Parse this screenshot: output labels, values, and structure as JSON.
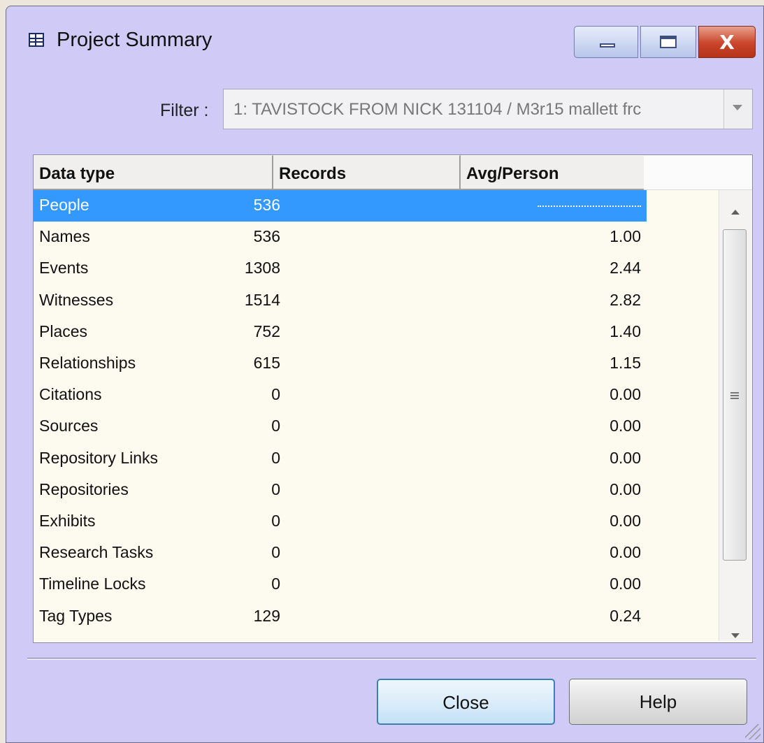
{
  "window": {
    "title": "Project Summary",
    "icon": "table-icon",
    "controls": [
      "minimize-icon",
      "maximize-icon",
      "close-icon"
    ],
    "close_glyph": "X"
  },
  "filter": {
    "label": "Filter :",
    "value": "1:  TAVISTOCK FROM NICK 131104 / M3r15 mallett frc"
  },
  "table": {
    "columns": [
      "Data type",
      "Records",
      "Avg/Person"
    ],
    "selected_row": 0,
    "rows": [
      {
        "type": "People",
        "records": "536",
        "avg": ""
      },
      {
        "type": "Names",
        "records": "536",
        "avg": "1.00"
      },
      {
        "type": "Events",
        "records": "1308",
        "avg": "2.44"
      },
      {
        "type": "Witnesses",
        "records": "1514",
        "avg": "2.82"
      },
      {
        "type": "Places",
        "records": "752",
        "avg": "1.40"
      },
      {
        "type": "Relationships",
        "records": "615",
        "avg": "1.15"
      },
      {
        "type": "Citations",
        "records": "0",
        "avg": "0.00"
      },
      {
        "type": "Sources",
        "records": "0",
        "avg": "0.00"
      },
      {
        "type": "Repository Links",
        "records": "0",
        "avg": "0.00"
      },
      {
        "type": "Repositories",
        "records": "0",
        "avg": "0.00"
      },
      {
        "type": "Exhibits",
        "records": "0",
        "avg": "0.00"
      },
      {
        "type": "Research Tasks",
        "records": "0",
        "avg": "0.00"
      },
      {
        "type": "Timeline Locks",
        "records": "0",
        "avg": "0.00"
      },
      {
        "type": "Tag Types",
        "records": "129",
        "avg": "0.24"
      }
    ]
  },
  "buttons": {
    "close": "Close",
    "help": "Help"
  },
  "colors": {
    "window_bg": "#cfcbf6",
    "grid_bg": "#fdfbf0",
    "selection": "#3399ff"
  }
}
